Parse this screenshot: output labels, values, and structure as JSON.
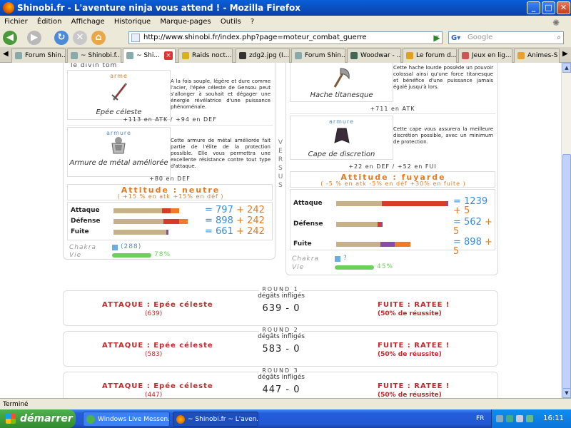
{
  "window": {
    "title": "Shinobi.fr - L'aventure ninja vous attend ! - Mozilla Firefox",
    "buttons": [
      "_",
      "□",
      "✕"
    ]
  },
  "menu": [
    "Fichier",
    "Édition",
    "Affichage",
    "Historique",
    "Marque-pages",
    "Outils",
    "?"
  ],
  "nav": {
    "url": "http://www.shinobi.fr/index.php?page=moteur_combat_guerre",
    "search_placeholder": "Google"
  },
  "tabs": [
    "Forum Shin...",
    "~ Shinobi.f...",
    "~ Shi...",
    "Raids noct...",
    "zdg2.jpg (I...",
    "Forum Shin...",
    "Woodwar - ...",
    "Le forum d...",
    "Jeux en lig...",
    "Animes-S"
  ],
  "left": {
    "title": "le divin tom",
    "weapon": {
      "category": "arme",
      "name": "Epée céleste",
      "desc": "A la fois souple, légère et dure comme l'acier, l'épée céleste de Gensou peut s'allonger à souhait et dégager une énergie révélatrice d'une puissance phénoménale.",
      "stat": "+113 en ATK / +94 en DEF"
    },
    "armor": {
      "category": "armure",
      "name": "Armure de métal améliorée",
      "desc": "Cette armure de métal améliorée fait partie de l'élite de la protection possible. Elle vous permettra une excellente résistance contre tout type d'attaque.",
      "stat": "+80 en DEF"
    },
    "attitude": "Attitude : neutre",
    "attitude_sub": "( +15 % en atk +15% en déf )",
    "stats": [
      {
        "label": "Attaque",
        "base": "797",
        "bonus": "242"
      },
      {
        "label": "Défense",
        "base": "898",
        "bonus": "242"
      },
      {
        "label": "Fuite",
        "base": "661",
        "bonus": "242"
      }
    ],
    "chakra_label": "Chakra",
    "chakra_value": "(288)",
    "vie_label": "Vie",
    "vie_value": "78%",
    "vie_fraction": 0.78
  },
  "versus": [
    "V",
    "E",
    "R",
    "S",
    "U",
    "S"
  ],
  "right": {
    "weapon": {
      "category": "arme",
      "name": "Hache titanesque",
      "desc": "Cette hache lourde possède un pouvoir colossal ainsi qu'une force titanesque et bénéfice d'une puissance jamais égalé jusqu'à lors.",
      "stat": "+711 en ATK"
    },
    "armor": {
      "category": "armure",
      "name": "Cape de discretion",
      "desc": "Cette cape vous assurera la meilleure discrétion possible, avec un minimum de protection.",
      "stat": "+22 en DEF / +52 en FUI"
    },
    "attitude": "Attitude : fuyarde",
    "attitude_sub": "( -5 % en atk -5% en déf +30% en fuite )",
    "stats": [
      {
        "label": "Attaque",
        "base": "1239",
        "bonus": "5"
      },
      {
        "label": "Défense",
        "base": "562",
        "bonus": "5"
      },
      {
        "label": "Fuite",
        "base": "898",
        "bonus": "5"
      }
    ],
    "chakra_label": "Chakra",
    "chakra_value": "?",
    "vie_label": "Vie",
    "vie_value": "45%",
    "vie_fraction": 0.45
  },
  "rounds": [
    {
      "label": "ROUND 1",
      "attack": "ATTAQUE : Epée céleste",
      "attack_num": "(639)",
      "degats_label": "dégâts infligés",
      "damage": "639 - 0",
      "fuite": "FUITE : RATEE !",
      "fuite_sub": "(50% de réussite)"
    },
    {
      "label": "ROUND 2",
      "attack": "ATTAQUE : Epée céleste",
      "attack_num": "(583)",
      "degats_label": "dégâts infligés",
      "damage": "583 - 0",
      "fuite": "FUITE : RATEE !",
      "fuite_sub": "(50% de réussite)"
    },
    {
      "label": "ROUND 3",
      "attack": "ATTAQUE : Epée céleste",
      "attack_num": "(447)",
      "degats_label": "dégâts infligés",
      "damage": "447 - 0",
      "fuite": "FUITE : RATEE !",
      "fuite_sub": "(50% de réussite)"
    }
  ],
  "status": "Terminé",
  "taskbar": {
    "start": "démarrer",
    "tasks": [
      "Windows Live Messen...",
      "~ Shinobi.fr ~ L'aven..."
    ],
    "lang": "FR",
    "clock": "16:11"
  },
  "colors": {
    "attitude": "#e07b25",
    "stat_value": "#3a8ad8",
    "round_red": "#c0282a",
    "vie_green": "#6bd05a",
    "chakra_blue": "#6aaee0"
  }
}
